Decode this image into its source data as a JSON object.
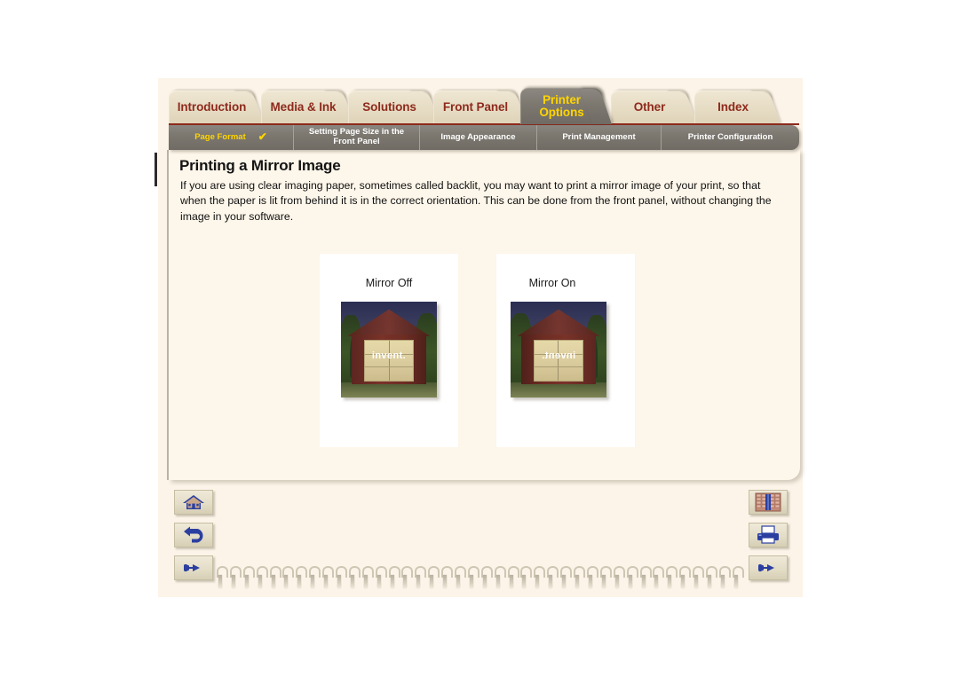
{
  "app": {
    "title": "Printing a Mirror Image"
  },
  "tabs": [
    {
      "label": "Introduction",
      "active": false
    },
    {
      "label": "Media & Ink",
      "active": false
    },
    {
      "label": "Solutions",
      "active": false
    },
    {
      "label": "Front Panel",
      "active": false
    },
    {
      "label": "Printer\nOptions",
      "active": true
    },
    {
      "label": "Other",
      "active": false
    },
    {
      "label": "Index",
      "active": false
    }
  ],
  "subnav": {
    "items": [
      {
        "label": "Page Format",
        "current": true,
        "check": "✔"
      },
      {
        "label": "Setting Page Size in the\nFront Panel",
        "current": false,
        "check": ""
      },
      {
        "label": "Image Appearance",
        "current": false,
        "check": ""
      },
      {
        "label": "Print Management",
        "current": false,
        "check": ""
      },
      {
        "label": "Printer Configuration",
        "current": false,
        "check": ""
      }
    ]
  },
  "content": {
    "title": "Printing a Mirror Image",
    "body": "If you are using clear imaging paper, sometimes called backlit, you may want to print a mirror image of your print, so that when the paper is lit from behind it is in the correct orientation. This can be done from the front panel, without changing the image in your software."
  },
  "figures": [
    {
      "caption": "Mirror Off",
      "image_text": "invent.",
      "mirrored": false
    },
    {
      "caption": "Mirror On",
      "image_text": "invent.",
      "mirrored": true
    }
  ],
  "nav_buttons": {
    "home": "home-icon",
    "back": "back-arrow-icon",
    "forward": "pointing-hand-icon",
    "index": "bookshelf-icon",
    "print": "printer-icon",
    "next": "pointing-hand-icon"
  },
  "colors": {
    "tab_inactive_bg": "#e6dcc4",
    "tab_text": "#8e2a1c",
    "tab_active_bg": "#7c7870",
    "tab_active_text": "#ffd400",
    "subnav_bg": "#7c7870",
    "subnav_current_text": "#ffd400",
    "page_bg": "#fcf4e8",
    "content_bg": "#fdf6ea",
    "card_bg": "#ffffff",
    "icon_blue": "#2b3fa0"
  }
}
